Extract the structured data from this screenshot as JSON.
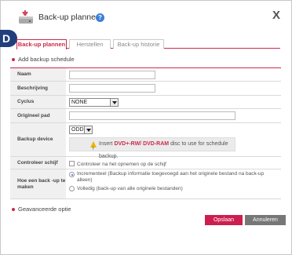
{
  "dialog": {
    "title": "Back-up plannen",
    "help_icon_glyph": "?",
    "close_glyph": "X",
    "step_badge": "D"
  },
  "tabs": [
    {
      "label": "Back-up plannen",
      "active": true
    },
    {
      "label": "Herstellen",
      "active": false
    },
    {
      "label": "Back-up historie",
      "active": false
    }
  ],
  "section": {
    "add_title": "Add backup schedule",
    "advanced_title": "Geavanceerde optie"
  },
  "form": {
    "naam_label": "Naam",
    "naam_value": "",
    "beschrijving_label": "Beschrijving",
    "beschrijving_value": "",
    "cyclus_label": "Cyclus",
    "cyclus_value": "NONE",
    "origineel_pad_label": "Origineel pad",
    "origineel_pad_value": "",
    "backup_device_label": "Backup device",
    "backup_device_value": "ODD",
    "warning_prefix": "Insert ",
    "warning_highlight": "DVD+-RW/ DVD-RAM",
    "warning_suffix": " disc to use for schedule backup.",
    "controleer_label": "Controleer schijf",
    "controleer_option": "Controleer na het opnemen op de schijf",
    "hoe_label": "Hoe een back -up te maken",
    "hoe_option_1": "Incrementeel (Backup informatie toegevoegd aan het originele bestand na back-up alleen)",
    "hoe_option_2": "Volledig (back-up van alle originele bestanden)"
  },
  "buttons": {
    "save": "Opslaan",
    "cancel": "Annuleren"
  },
  "colors": {
    "accent": "#cc2a4d",
    "save_button": "#cc1f4f",
    "cancel_button": "#777777",
    "badge": "#213f7c"
  },
  "icons": {
    "app": "backup-drive-icon",
    "help": "help-icon",
    "folder": "folder-icon",
    "warning": "warning-icon"
  }
}
